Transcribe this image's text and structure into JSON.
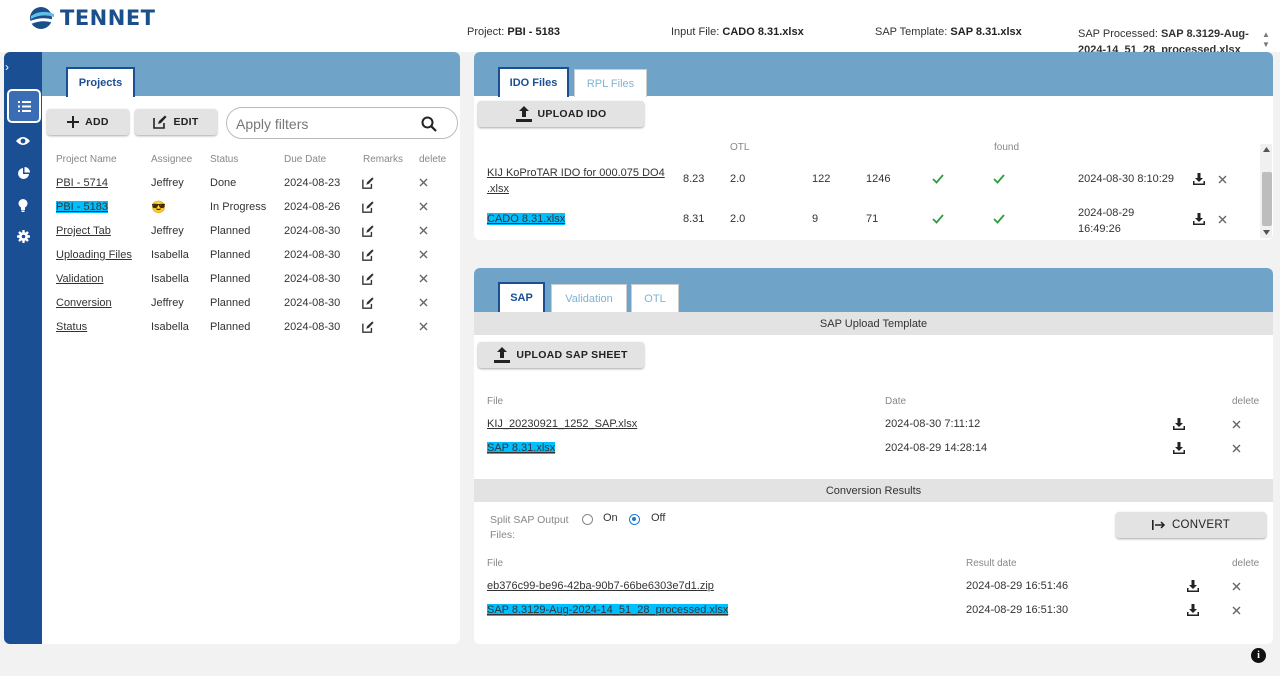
{
  "header": {
    "logo_text": "TENNET",
    "project_label": "Project:",
    "project_value": "PBI - 5183",
    "input_label": "Input File:",
    "input_value": "CADO 8.31.xlsx",
    "template_label": "SAP Template:",
    "template_value": "SAP 8.31.xlsx",
    "processed_label": "SAP Processed:",
    "processed_value": "SAP 8.3129-Aug-2024-14_51_28_processed.xlsx"
  },
  "sidebar": {
    "toggle": "›"
  },
  "projects": {
    "tab_label": "Projects",
    "add_label": "ADD",
    "edit_label": "EDIT",
    "filter_placeholder": "Apply filters",
    "columns": [
      "Project Name",
      "Assignee",
      "Status",
      "Due Date",
      "Remarks",
      "delete"
    ],
    "rows": [
      {
        "name": "PBI - 5714",
        "assignee": "Jeffrey",
        "status": "Done",
        "due": "2024-08-23"
      },
      {
        "name": "PBI - 5183",
        "assignee": "😎",
        "status": "In Progress",
        "due": "2024-08-26"
      },
      {
        "name": "Project Tab",
        "assignee": "Jeffrey",
        "status": "Planned",
        "due": "2024-08-30"
      },
      {
        "name": "Uploading Files",
        "assignee": "Isabella",
        "status": "Planned",
        "due": "2024-08-30"
      },
      {
        "name": "Validation",
        "assignee": "Isabella",
        "status": "Planned",
        "due": "2024-08-30"
      },
      {
        "name": "Conversion",
        "assignee": "Jeffrey",
        "status": "Planned",
        "due": "2024-08-30"
      },
      {
        "name": "Status",
        "assignee": "Isabella",
        "status": "Planned",
        "due": "2024-08-30"
      }
    ]
  },
  "ido": {
    "tab_ido": "IDO Files",
    "tab_rpl": "RPL Files",
    "upload_label": "UPLOAD IDO",
    "col_otl": "OTL",
    "col_found": "found",
    "rows": [
      {
        "file_line1": "KIJ KoProTAR IDO for 000.075 DO4",
        "file_line2": ".xlsx",
        "version": "8.23",
        "otl": "2.0",
        "count1": "122",
        "count2": "1246",
        "date": "2024-08-30 8:10:29"
      },
      {
        "file_line1": "CADO 8.31.xlsx",
        "file_line2": "",
        "version": "8.31",
        "otl": "2.0",
        "count1": "9",
        "count2": "71",
        "date_line1": "2024-08-29",
        "date_line2": "16:49:26"
      }
    ]
  },
  "sap": {
    "tab_sap": "SAP",
    "tab_validation": "Validation",
    "tab_otl": "OTL",
    "template_bar": "SAP Upload Template",
    "upload_label": "UPLOAD SAP SHEET",
    "col_file": "File",
    "col_date": "Date",
    "col_delete": "delete",
    "files": [
      {
        "name": "KIJ_20230921_1252_SAP.xlsx",
        "date": "2024-08-30 7:11:12"
      },
      {
        "name": "SAP 8.31.xlsx",
        "date": "2024-08-29 14:28:14"
      }
    ],
    "results_bar": "Conversion Results",
    "split_label": "Split SAP Output Files:",
    "on_label": "On",
    "off_label": "Off",
    "convert_label": "CONVERT",
    "result_col_file": "File",
    "result_col_date": "Result date",
    "result_col_delete": "delete",
    "results": [
      {
        "name": "eb376c99-be96-42ba-90b7-66be6303e7d1.zip",
        "date": "2024-08-29 16:51:46"
      },
      {
        "name": "SAP 8.3129-Aug-2024-14_51_28_processed.xlsx",
        "date": "2024-08-29 16:51:30"
      }
    ]
  },
  "colors": {
    "brand_blue": "#1b4f94",
    "panel_header": "#6fa3c7",
    "highlight": "#00bfff",
    "check_green": "#2e9e3e"
  }
}
